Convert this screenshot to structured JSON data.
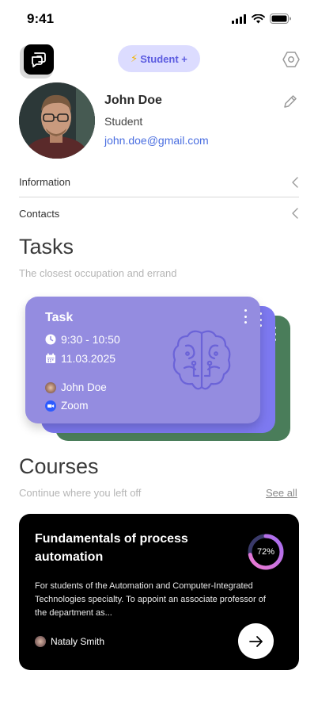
{
  "status_bar": {
    "time": "9:41"
  },
  "header": {
    "plan_badge": "Student +"
  },
  "profile": {
    "name": "John Doe",
    "role": "Student",
    "email": "john.doe@gmail.com"
  },
  "menu": {
    "information": "Information",
    "contacts": "Contacts"
  },
  "tasks": {
    "title": "Tasks",
    "subtitle": "The closest occupation and errand",
    "card": {
      "title": "Task",
      "time": "9:30 - 10:50",
      "date": "11.03.2025",
      "person": "John Doe",
      "platform": "Zoom"
    }
  },
  "courses": {
    "title": "Courses",
    "subtitle": "Continue where you left off",
    "see_all": "See all",
    "card": {
      "title": "Fundamentals of process automation",
      "description": "For students of the Automation and Computer-Integrated Technologies specialty. To appoint an associate professor of the department as...",
      "progress_label": "72%",
      "progress_value": 0.72,
      "author": "Nataly Smith"
    }
  },
  "colors": {
    "accent": "#5c5ce0",
    "badge_bg": "#dcdcff",
    "link": "#4a6ee0",
    "task_front": "#948ce0",
    "task_mid": "#7d79f0",
    "task_back": "#4a7d5a",
    "course_bg": "#000000"
  }
}
